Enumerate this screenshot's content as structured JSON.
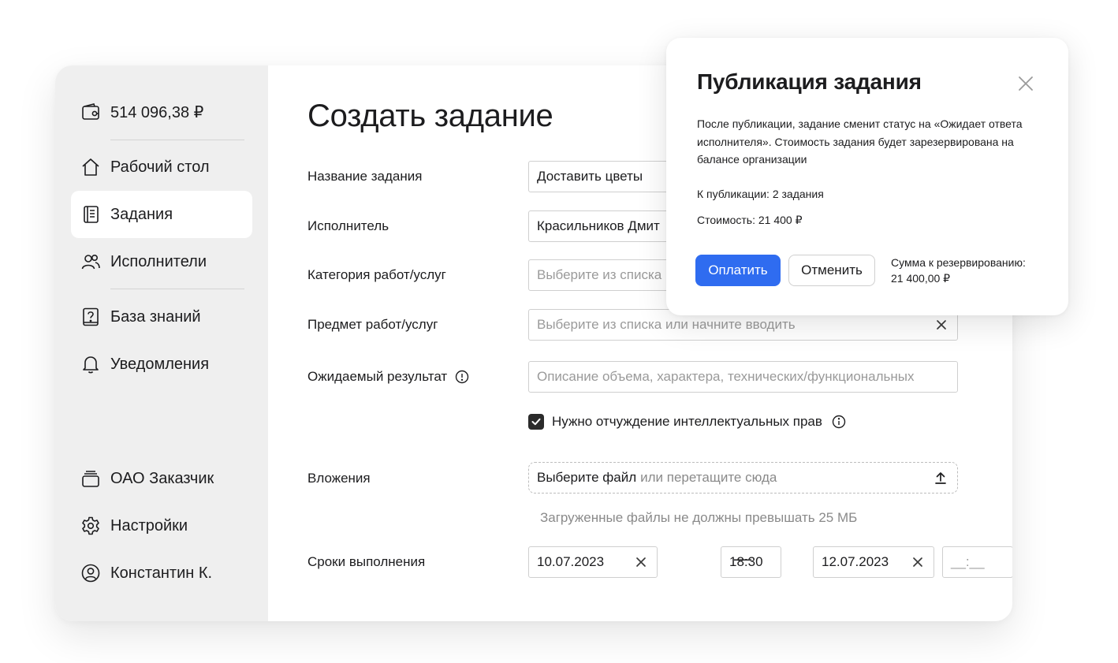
{
  "sidebar": {
    "balance": "514 096,38 ₽",
    "items": [
      {
        "label": "Рабочий стол",
        "icon": "home-icon"
      },
      {
        "label": "Задания",
        "icon": "document-icon",
        "active": true
      },
      {
        "label": "Исполнители",
        "icon": "users-icon"
      },
      {
        "label": "База знаний",
        "icon": "question-book-icon"
      },
      {
        "label": "Уведомления",
        "icon": "bell-icon"
      }
    ],
    "bottom": [
      {
        "label": "ОАО Заказчик",
        "icon": "organization-icon"
      },
      {
        "label": "Настройки",
        "icon": "gear-icon"
      },
      {
        "label": "Константин К.",
        "icon": "user-circle-icon"
      }
    ]
  },
  "form": {
    "title": "Создать задание",
    "name": {
      "label": "Название задания",
      "value": "Доставить цветы"
    },
    "executor": {
      "label": "Исполнитель",
      "value": "Красильников Дмит"
    },
    "category": {
      "label": "Категория работ/услуг",
      "placeholder": "Выберите из списка"
    },
    "subject": {
      "label": "Предмет работ/услуг",
      "placeholder": "Выберите из списка или начните вводить"
    },
    "result": {
      "label": "Ожидаемый результат",
      "placeholder": "Описание объема, характера, технических/функциональных"
    },
    "ip_rights": {
      "label": "Нужно отчуждение интеллектуальных прав",
      "checked": true
    },
    "attachments": {
      "label": "Вложения",
      "choose": "Выберите файл",
      "or_drag": "или перетащите сюда",
      "hint": "Загруженные файлы не должны превышать 25 МБ"
    },
    "deadline": {
      "label": "Сроки выполнения",
      "start_date": "10.07.2023",
      "start_time": "18:30",
      "separator": "—",
      "end_date": "12.07.2023",
      "end_time_placeholder": "__:__"
    }
  },
  "modal": {
    "title": "Публикация задания",
    "description": "После публикации, задание сменит статус на «Ожидает ответа исполнителя». Стоимость задания будет зарезервирована на балансе организации",
    "to_publish": "К публикации: 2 задания",
    "cost": "Стоимость: 21 400 ₽",
    "pay_label": "Оплатить",
    "cancel_label": "Отменить",
    "reserve_label": "Сумма к резервированию:",
    "reserve_value": "21 400,00 ₽"
  },
  "colors": {
    "accent": "#2f6cf0",
    "sidebar_bg": "#efefef"
  }
}
